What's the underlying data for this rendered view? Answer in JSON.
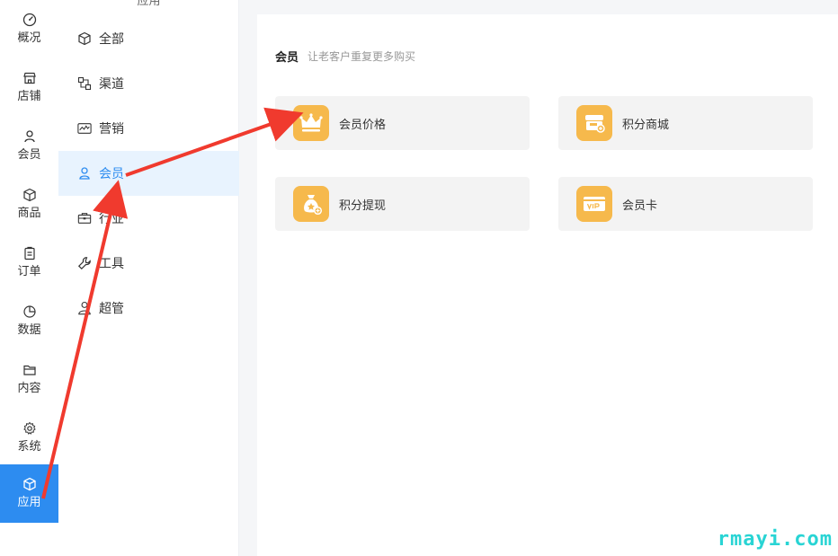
{
  "rail": {
    "items": [
      {
        "label": "概况",
        "icon": "dashboard-icon"
      },
      {
        "label": "店铺",
        "icon": "store-icon"
      },
      {
        "label": "会员",
        "icon": "user-icon"
      },
      {
        "label": "商品",
        "icon": "box-icon"
      },
      {
        "label": "订单",
        "icon": "clipboard-icon"
      },
      {
        "label": "数据",
        "icon": "pie-chart-icon"
      },
      {
        "label": "内容",
        "icon": "folder-icon"
      },
      {
        "label": "系统",
        "icon": "gear-icon"
      },
      {
        "label": "应用",
        "icon": "cube-icon"
      }
    ],
    "active_label": "应用",
    "accent_color": "#2d8cf0"
  },
  "sidebar": {
    "heading": "应用",
    "items": [
      {
        "label": "全部",
        "icon": "cube-icon"
      },
      {
        "label": "渠道",
        "icon": "channels-icon"
      },
      {
        "label": "营销",
        "icon": "trend-chart-icon"
      },
      {
        "label": "会员",
        "icon": "user-icon"
      },
      {
        "label": "行业",
        "icon": "briefcase-icon"
      },
      {
        "label": "工具",
        "icon": "wrench-icon"
      },
      {
        "label": "超管",
        "icon": "admin-icon"
      }
    ],
    "active_label": "会员"
  },
  "main": {
    "section_title": "会员",
    "section_subtitle": "让老客户重复更多购买",
    "cards": [
      {
        "label": "会员价格",
        "icon": "crown-icon"
      },
      {
        "label": "积分商城",
        "icon": "points-mall-icon"
      },
      {
        "label": "积分提现",
        "icon": "money-bag-icon"
      },
      {
        "label": "会员卡",
        "icon": "vip-card-icon"
      }
    ],
    "card_icon_color": "#f6b94c"
  },
  "annotation_color": "#f03a2e",
  "watermark": "rmayi.com"
}
